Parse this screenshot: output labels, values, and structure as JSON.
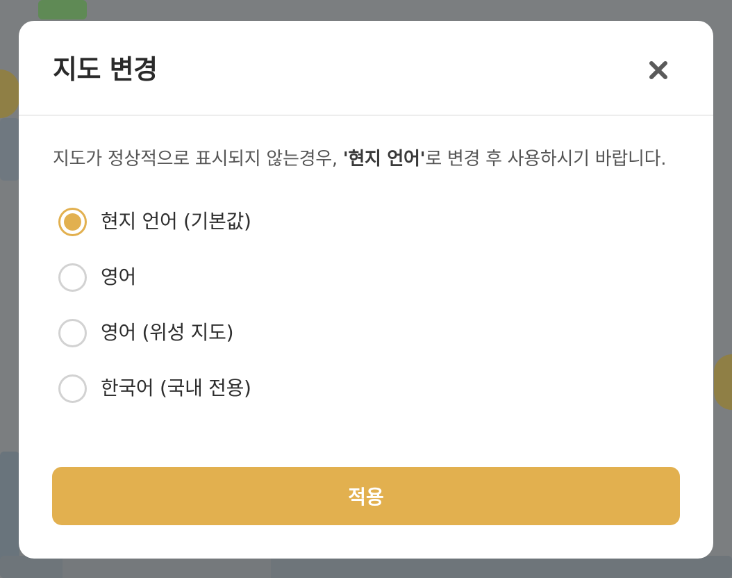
{
  "modal": {
    "title": "지도 변경",
    "description_before": "지도가 정상적으로 표시되지 않는경우, ",
    "description_highlight": "'현지 언어'",
    "description_after": "로 변경 후 사용하시기 바랍니다.",
    "options": [
      {
        "label": "현지 언어 (기본값)",
        "selected": true
      },
      {
        "label": "영어",
        "selected": false
      },
      {
        "label": "영어 (위성 지도)",
        "selected": false
      },
      {
        "label": "한국어 (국내 전용)",
        "selected": false
      }
    ],
    "apply_label": "적용",
    "close_icon": "close-icon"
  },
  "colors": {
    "accent": "#e2b04f",
    "radio_unselected": "#d2d2d2",
    "title_text": "#2a2a2a",
    "body_text": "#555555",
    "overlay": "#7b7e80"
  }
}
